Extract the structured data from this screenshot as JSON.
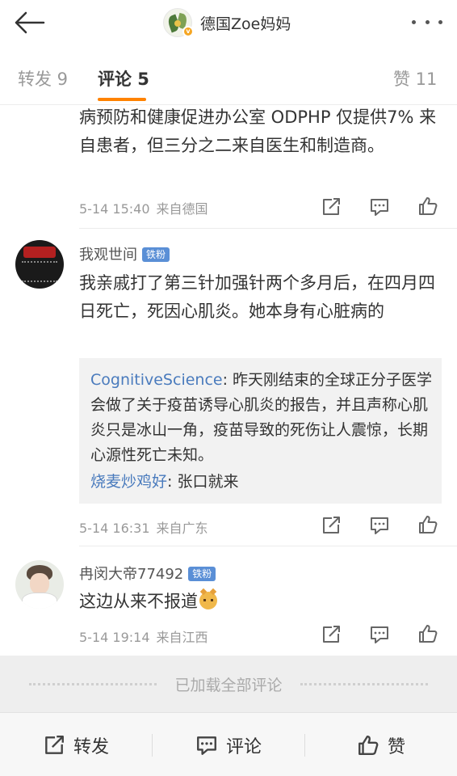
{
  "header": {
    "title": "德国Zoe妈妈",
    "verified_badge": "v",
    "back_icon": "back-arrow-icon",
    "more_icon": "more-dots-icon"
  },
  "tabs": [
    {
      "label": "转发 9"
    },
    {
      "label": "评论 5"
    },
    {
      "label": "赞 11"
    }
  ],
  "comments": [
    {
      "text": "病预防和健康促进办公室 ODPHP 仅提供7% 来自患者，但三分之二来自医生和制造商。",
      "time": "5-14 15:40",
      "source": "来自德国"
    },
    {
      "user": "我观世间",
      "badge": "铁粉",
      "text": "我亲戚打了第三针加强针两个多月后，在四月四日死亡，死因心肌炎。她本身有心脏病的",
      "quote_user": "CognitiveScience",
      "quote_text": ": 昨天刚结束的全球正分子医学会做了关于疫苗诱导心肌炎的报告，并且声称心肌炎只是冰山一角，疫苗导致的死伤让人震惊，长期心源性死亡未知。",
      "reply_user": "烧麦炒鸡好",
      "reply_text": ": 张口就来",
      "time": "5-14 16:31",
      "source": "来自广东"
    },
    {
      "user": "冉闵大帝77492",
      "badge": "铁粉",
      "text": "这边从来不报道",
      "time": "5-14 19:14",
      "source": "来自江西"
    }
  ],
  "footer": {
    "loaded_text": "已加载全部评论",
    "repost": "转发",
    "comment": "评论",
    "like": "赞"
  },
  "colors": {
    "accent": "#ff8200",
    "link": "#4a7bbd",
    "fan_badge": "#5a8fd6"
  }
}
